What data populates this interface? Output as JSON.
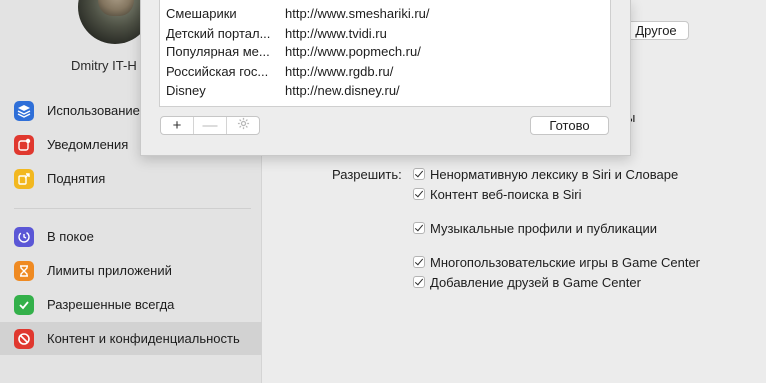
{
  "user": {
    "name": "Dmitry IT-H"
  },
  "sidebar": {
    "items": [
      {
        "label": "Использование",
        "icon": "layers-icon",
        "color": "#2f6fd8"
      },
      {
        "label": "Уведомления",
        "icon": "notification-icon",
        "color": "#e0382f"
      },
      {
        "label": "Поднятия",
        "icon": "pickups-icon",
        "color": "#f2b820"
      },
      {
        "label": "В покое",
        "icon": "downtime-icon",
        "color": "#5b57d6"
      },
      {
        "label": "Лимиты приложений",
        "icon": "hourglass-icon",
        "color": "#ef8a22"
      },
      {
        "label": "Разрешенные всегда",
        "icon": "check-badge-icon",
        "color": "#33b04a"
      },
      {
        "label": "Контент и конфиденциальность",
        "icon": "restriction-icon",
        "color": "#e0382f"
      }
    ]
  },
  "main": {
    "other_button": "Другое",
    "partial_text": "ы",
    "allow_label": "Разрешить:",
    "checks": [
      {
        "label": "Ненормативную лексику в Siri и Словаре",
        "checked": true
      },
      {
        "label": "Контент веб-поиска в Siri",
        "checked": true
      },
      {
        "label": "Музыкальные профили и публикации",
        "checked": true
      },
      {
        "label": "Многопользовательские игры в Game Center",
        "checked": true
      },
      {
        "label": "Добавление друзей в Game Center",
        "checked": true
      }
    ]
  },
  "sheet": {
    "sites": [
      {
        "name": "Смешарики",
        "url": "http://www.smeshariki.ru/"
      },
      {
        "name": "Детский портал...",
        "url": "http://www.tvidi.ru"
      },
      {
        "name": "Популярная ме...",
        "url": "http://www.popmech.ru/"
      },
      {
        "name": "Российская гос...",
        "url": "http://www.rgdb.ru/"
      },
      {
        "name": "Disney",
        "url": "http://new.disney.ru/"
      }
    ],
    "add_symbol": "+",
    "remove_symbol": "—",
    "done_button": "Готово"
  }
}
